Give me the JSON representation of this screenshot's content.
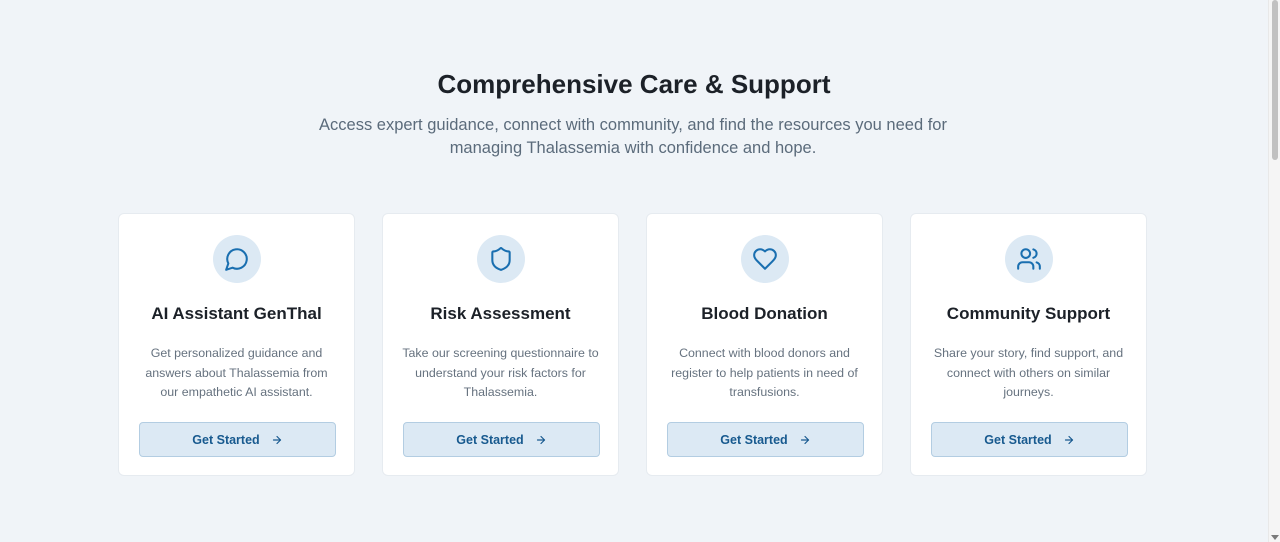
{
  "section": {
    "title": "Comprehensive Care & Support",
    "subtitle_line1": "Access expert guidance, connect with community, and find the resources you need for",
    "subtitle_line2": "managing Thalassemia with confidence and hope."
  },
  "cards": [
    {
      "icon": "chat-bubble-icon",
      "title": "AI Assistant GenThal",
      "description": "Get personalized guidance and answers about Thalassemia from our empathetic AI assistant.",
      "button_label": "Get Started"
    },
    {
      "icon": "shield-icon",
      "title": "Risk Assessment",
      "description": "Take our screening questionnaire to understand your risk factors for Thalassemia.",
      "button_label": "Get Started"
    },
    {
      "icon": "heart-icon",
      "title": "Blood Donation",
      "description": "Connect with blood donors and register to help patients in need of transfusions.",
      "button_label": "Get Started"
    },
    {
      "icon": "users-icon",
      "title": "Community Support",
      "description": "Share your story, find support, and connect with others on similar journeys.",
      "button_label": "Get Started"
    }
  ],
  "colors": {
    "background": "#f0f4f8",
    "accent": "#1a6fb0",
    "icon_bg": "#dce9f4",
    "button_bg": "#dce9f4",
    "button_text": "#185a8f"
  }
}
